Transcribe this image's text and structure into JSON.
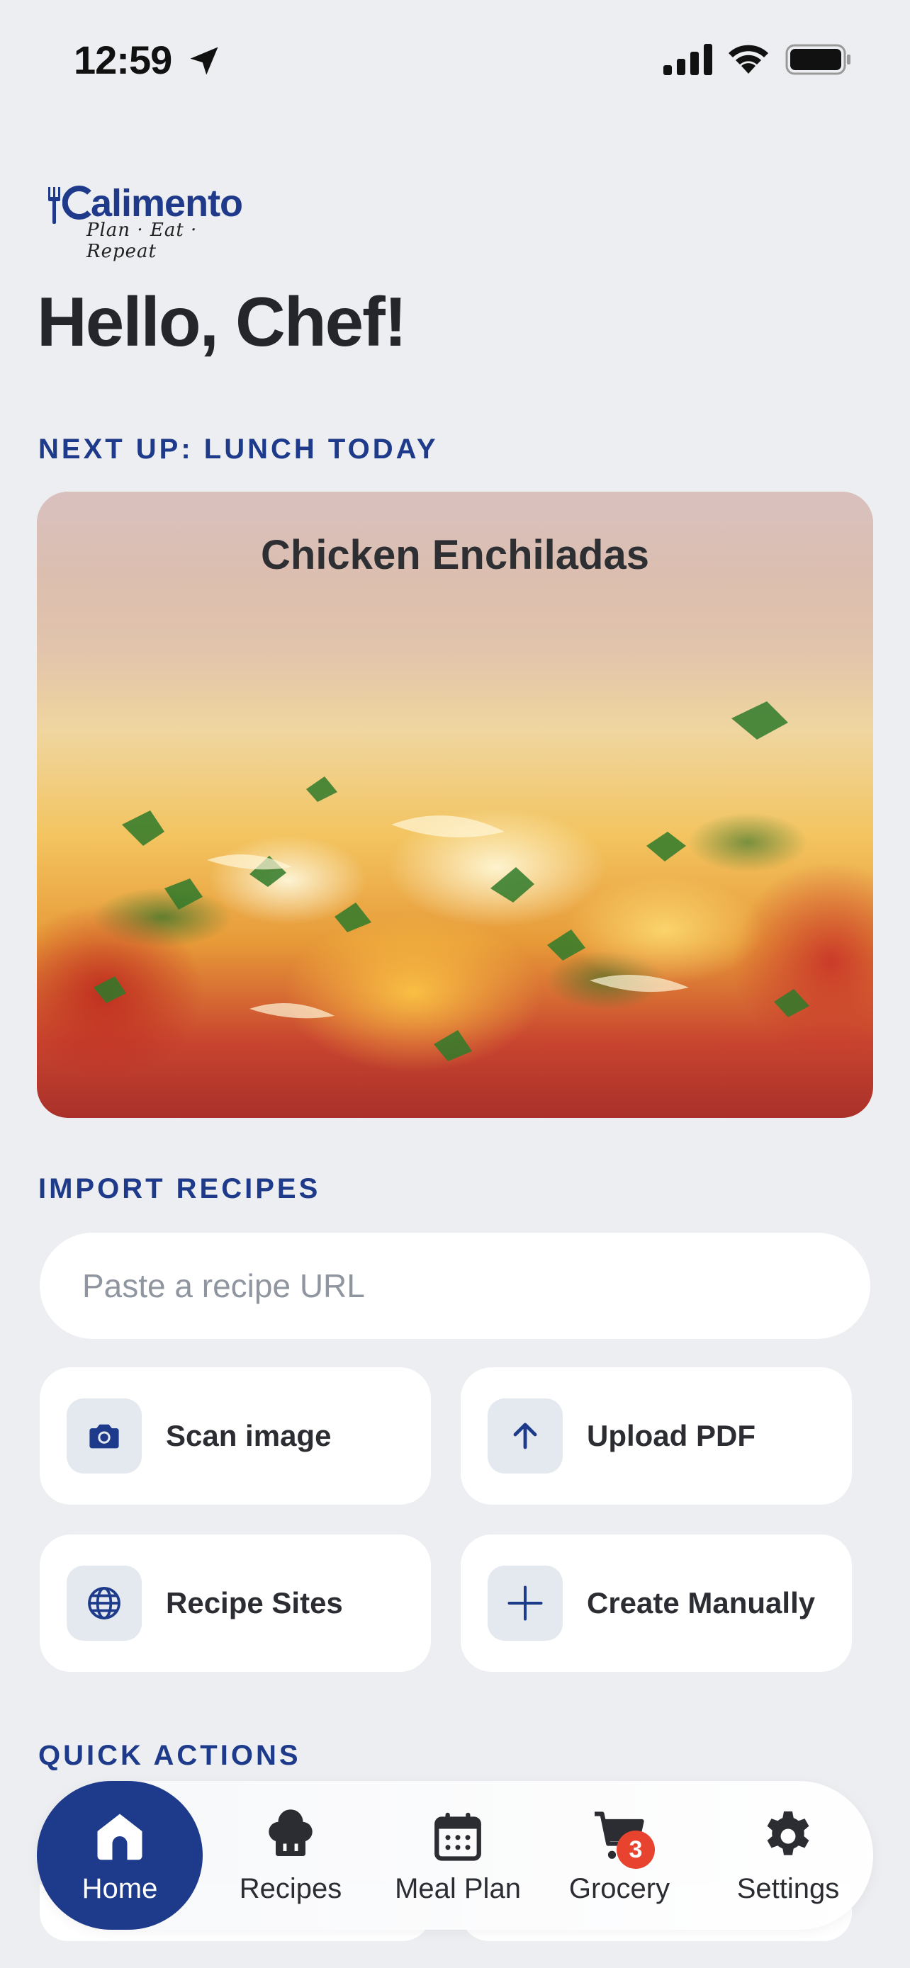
{
  "status_bar": {
    "time": "12:59"
  },
  "logo": {
    "wordmark": "alimento",
    "tagline": "Plan · Eat · Repeat"
  },
  "greeting": "Hello, Chef!",
  "next_up": {
    "label": "NEXT UP: LUNCH TODAY",
    "recipe_title": "Chicken Enchiladas"
  },
  "import": {
    "label": "IMPORT RECIPES",
    "url_placeholder": "Paste a recipe URL",
    "tiles": [
      {
        "label": "Scan image",
        "icon": "camera-icon"
      },
      {
        "label": "Upload PDF",
        "icon": "arrow-up-icon"
      },
      {
        "label": "Recipe Sites",
        "icon": "globe-icon"
      },
      {
        "label": "Create Manually",
        "icon": "plus-icon"
      }
    ]
  },
  "quick_actions": {
    "label": "QUICK ACTIONS"
  },
  "tab_bar": {
    "tabs": [
      {
        "label": "Home",
        "icon": "home-icon",
        "active": true
      },
      {
        "label": "Recipes",
        "icon": "chef-hat-icon"
      },
      {
        "label": "Meal Plan",
        "icon": "calendar-icon"
      },
      {
        "label": "Grocery",
        "icon": "cart-icon",
        "badge": "3"
      },
      {
        "label": "Settings",
        "icon": "gear-icon"
      }
    ]
  },
  "colors": {
    "accent": "#1E3A8A",
    "background": "#EDEEF1",
    "badge": "#E8432F"
  }
}
